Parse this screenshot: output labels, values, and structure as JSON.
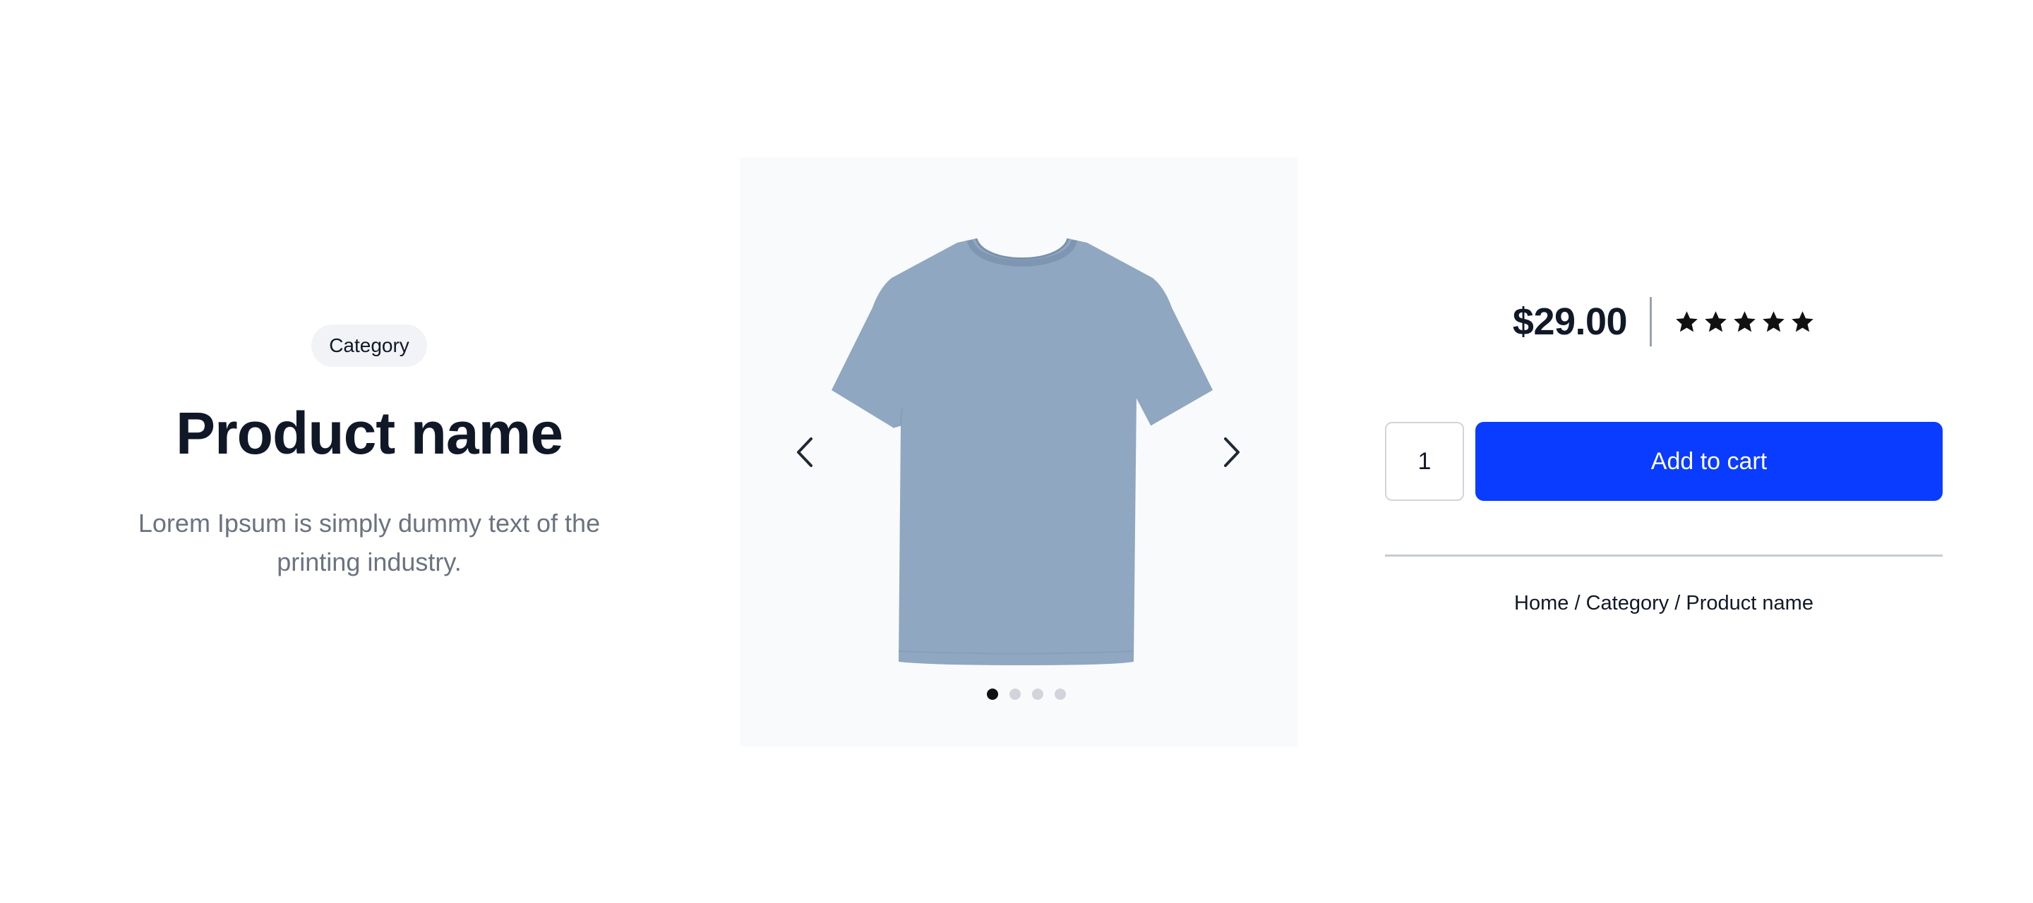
{
  "product": {
    "category": "Category",
    "name": "Product name",
    "description": "Lorem Ipsum is simply dummy text of the printing industry.",
    "price": "$29.00",
    "rating": 5,
    "rating_max": 5,
    "image_color": "#8fa7c1"
  },
  "gallery": {
    "image": "t-shirt-image",
    "prev_icon": "chevron-left-icon",
    "next_icon": "chevron-right-icon",
    "slides_count": 4,
    "active_slide": 1
  },
  "cart": {
    "quantity": "1",
    "add_label": "Add to cart",
    "button_color": "#0a3cff"
  },
  "breadcrumb": {
    "items": [
      "Home",
      "Category",
      "Product name"
    ],
    "separator": " / "
  }
}
